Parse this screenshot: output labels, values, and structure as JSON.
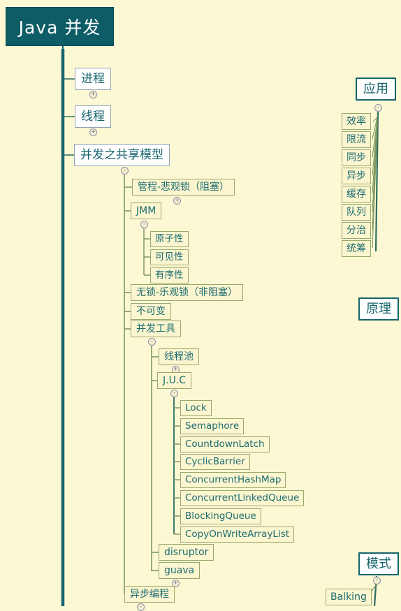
{
  "diagram": {
    "type": "mindmap",
    "title": "Java 并发",
    "colors": {
      "background": "#fdf8d4",
      "root_fill": "#0d5c66",
      "root_text": "#ffffff",
      "level1_border": "#90a4b4",
      "node_border": "#9aa86a",
      "node_fill": "#fbf6cf",
      "node_text": "#1d6b72",
      "trunk": "#17656e",
      "branch_line": "#4e8d6e"
    }
  },
  "root": {
    "label": "Java 并发"
  },
  "main_branch": {
    "children": [
      {
        "label": "进程",
        "toggle": "+"
      },
      {
        "label": "线程",
        "toggle": "+"
      },
      {
        "label": "并发之共享模型",
        "toggle": "-"
      }
    ]
  },
  "shared_model": {
    "children": [
      {
        "label": "管程-悲观锁（阻塞）",
        "toggle": "+"
      },
      {
        "label": "JMM",
        "toggle": "-"
      },
      {
        "label": "无锁-乐观锁（非阻塞）",
        "toggle": null
      },
      {
        "label": "不可变",
        "toggle": null
      },
      {
        "label": "并发工具",
        "toggle": "-"
      },
      {
        "label": "异步编程",
        "toggle": "-"
      }
    ]
  },
  "jmm": {
    "children": [
      {
        "label": "原子性"
      },
      {
        "label": "可见性"
      },
      {
        "label": "有序性"
      }
    ]
  },
  "concurrency_tools": {
    "children": [
      {
        "label": "线程池",
        "toggle": "+"
      },
      {
        "label": "J.U.C",
        "toggle": "-"
      },
      {
        "label": "disruptor",
        "toggle": null
      },
      {
        "label": "guava",
        "toggle": "+"
      }
    ]
  },
  "juc": {
    "children": [
      {
        "label": "Lock"
      },
      {
        "label": "Semaphore"
      },
      {
        "label": "CountdownLatch"
      },
      {
        "label": "CyclicBarrier"
      },
      {
        "label": "ConcurrentHashMap"
      },
      {
        "label": "ConcurrentLinkedQueue"
      },
      {
        "label": "BlockingQueue"
      },
      {
        "label": "CopyOnWriteArrayList"
      }
    ]
  },
  "application_branch": {
    "label": "应用",
    "toggle": "-",
    "children": [
      {
        "label": "效率"
      },
      {
        "label": "限流"
      },
      {
        "label": "同步"
      },
      {
        "label": "异步"
      },
      {
        "label": "缓存"
      },
      {
        "label": "队列"
      },
      {
        "label": "分治"
      },
      {
        "label": "统筹"
      }
    ]
  },
  "principle_branch": {
    "label": "原理"
  },
  "pattern_branch": {
    "label": "模式",
    "toggle": "-",
    "children": [
      {
        "label": "Balking"
      }
    ]
  }
}
